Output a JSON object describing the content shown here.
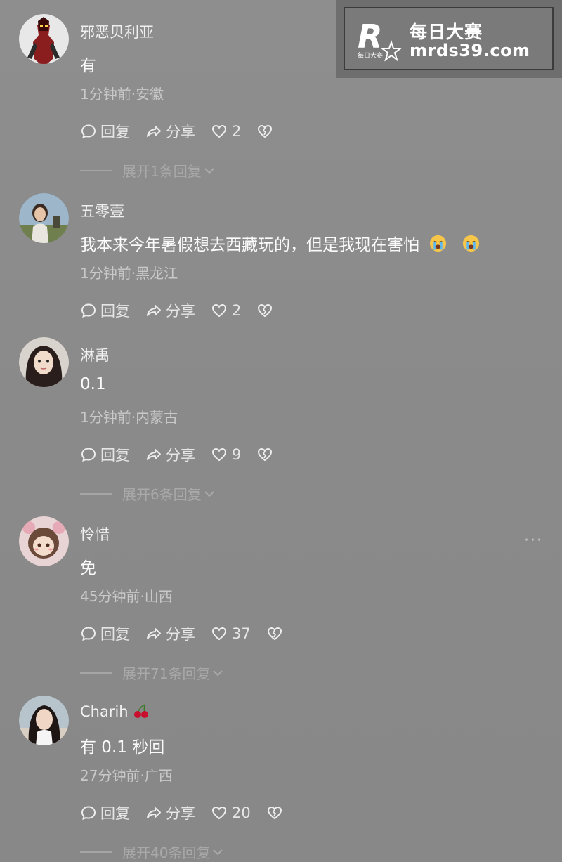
{
  "watermark": {
    "title": "每日大赛",
    "url": "mrds39.com",
    "logo_letter": "R",
    "logo_subtext": "每日大赛"
  },
  "actions": {
    "reply_label": "回复",
    "share_label": "分享"
  },
  "comments": [
    {
      "username": "邪恶贝利亚",
      "text": "有",
      "time_location": "1分钟前·安徽",
      "likes": "2",
      "expand_label": "展开1条回复"
    },
    {
      "username": "五零壹",
      "text": "我本来今年暑假想去西藏玩的，但是我现在害怕",
      "emojis": [
        "crying-emoji",
        "crying-emoji"
      ],
      "time_location": "1分钟前·黑龙江",
      "likes": "2",
      "expand_label": ""
    },
    {
      "username": "淋禹",
      "text": "0.1",
      "time_location": "1分钟前·内蒙古",
      "likes": "9",
      "expand_label": "展开6条回复"
    },
    {
      "username": "怜惜",
      "text": "免",
      "time_location": "45分钟前·山西",
      "likes": "37",
      "expand_label": "展开71条回复",
      "more": "···"
    },
    {
      "username": "Charih",
      "username_emoji": "cherry-emoji",
      "text": "有 0.1 秒回",
      "time_location": "27分钟前·广西",
      "likes": "20",
      "expand_label": "展开40条回复"
    }
  ],
  "colors": {
    "background": "#8b8b8b",
    "text": "#f2f2f2",
    "meta": "#c9c9c9",
    "watermark_bg": "#7a7a7a"
  }
}
